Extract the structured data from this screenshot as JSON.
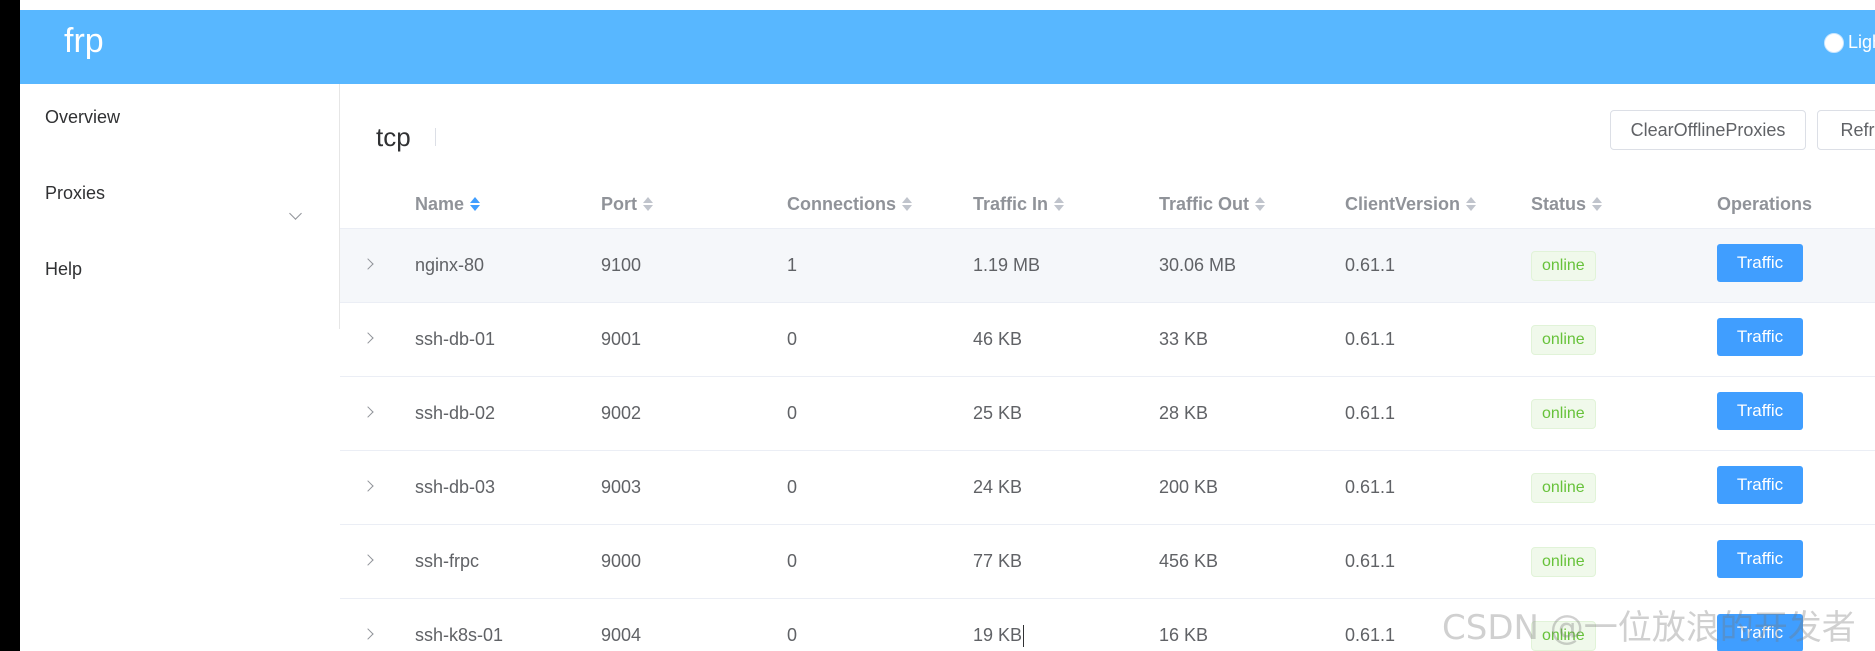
{
  "header": {
    "brand": "frp",
    "theme_label": "Ligh"
  },
  "sidebar": {
    "items": [
      {
        "label": "Overview"
      },
      {
        "label": "Proxies"
      },
      {
        "label": "Help"
      }
    ]
  },
  "main": {
    "title": "tcp",
    "buttons": {
      "clear": "ClearOfflineProxies",
      "refresh": "Refresh"
    }
  },
  "table": {
    "columns": [
      "Name",
      "Port",
      "Connections",
      "Traffic In",
      "Traffic Out",
      "ClientVersion",
      "Status",
      "Operations"
    ],
    "sort_active": "Name",
    "action_label": "Traffic",
    "rows": [
      {
        "name": "nginx-80",
        "port": "9100",
        "connections": "1",
        "traffic_in": "1.19 MB",
        "traffic_out": "30.06 MB",
        "client_version": "0.61.1",
        "status": "online"
      },
      {
        "name": "ssh-db-01",
        "port": "9001",
        "connections": "0",
        "traffic_in": "46 KB",
        "traffic_out": "33 KB",
        "client_version": "0.61.1",
        "status": "online"
      },
      {
        "name": "ssh-db-02",
        "port": "9002",
        "connections": "0",
        "traffic_in": "25 KB",
        "traffic_out": "28 KB",
        "client_version": "0.61.1",
        "status": "online"
      },
      {
        "name": "ssh-db-03",
        "port": "9003",
        "connections": "0",
        "traffic_in": "24 KB",
        "traffic_out": "200 KB",
        "client_version": "0.61.1",
        "status": "online"
      },
      {
        "name": "ssh-frpc",
        "port": "9000",
        "connections": "0",
        "traffic_in": "77 KB",
        "traffic_out": "456 KB",
        "client_version": "0.61.1",
        "status": "online"
      },
      {
        "name": "ssh-k8s-01",
        "port": "9004",
        "connections": "0",
        "traffic_in": "19 KB",
        "traffic_out": "16 KB",
        "client_version": "0.61.1",
        "status": "online"
      }
    ]
  },
  "watermark": "CSDN @一位放浪的开发者",
  "colors": {
    "header_bg": "#58b7ff",
    "primary": "#409eff",
    "success": "#67c23a"
  }
}
